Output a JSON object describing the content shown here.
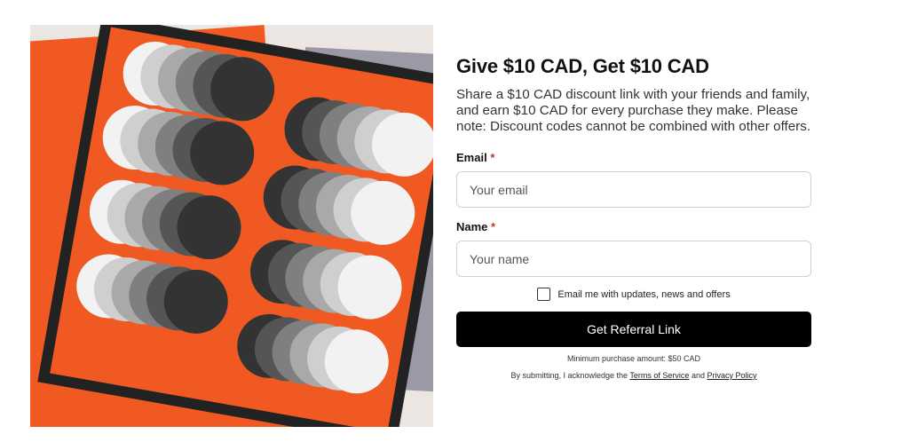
{
  "hero": {
    "alt": "Orange op-art print with grey gradient circles"
  },
  "form": {
    "title": "Give $10 CAD, Get $10 CAD",
    "description": "Share a $10 CAD discount link with your friends and family, and earn $10 CAD for every purchase they make. Please note: Discount codes cannot be combined with other offers.",
    "email": {
      "label": "Email",
      "required_mark": "*",
      "placeholder": "Your email",
      "value": ""
    },
    "name": {
      "label": "Name",
      "required_mark": "*",
      "placeholder": "Your name",
      "value": ""
    },
    "consent_label": "Email me with updates, news and offers",
    "consent_checked": false,
    "submit_label": "Get Referral Link",
    "min_purchase": "Minimum purchase amount: $50 CAD",
    "legal_prefix": "By submitting, I acknowledge the",
    "terms_label": "Terms of Service",
    "legal_and": "and",
    "privacy_label": "Privacy Policy"
  },
  "colors": {
    "accent_orange": "#f05a22",
    "button_bg": "#000000",
    "required": "#c0392b"
  }
}
